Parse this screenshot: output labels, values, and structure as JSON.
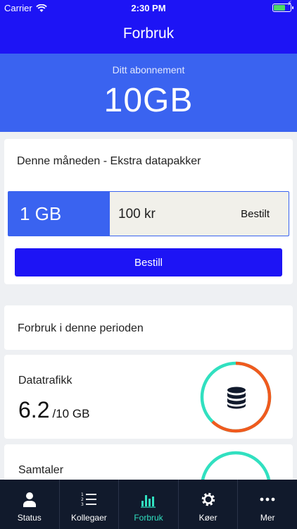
{
  "status_bar": {
    "carrier": "Carrier",
    "time": "2:30 PM"
  },
  "header": {
    "title": "Forbruk"
  },
  "subscription": {
    "label": "Ditt abonnement",
    "value": "10GB"
  },
  "extra_packages": {
    "title": "Denne måneden - Ekstra datapakker",
    "package": {
      "size": "1 GB",
      "price": "100 kr",
      "status": "Bestilt"
    },
    "order_button": "Bestill"
  },
  "period": {
    "title": "Forbruk i denne perioden"
  },
  "data_usage": {
    "label": "Datatrafikk",
    "used": "6.2",
    "limit": "/10 GB",
    "fraction": 0.62
  },
  "calls_usage": {
    "label": "Samtaler"
  },
  "colors": {
    "primary": "#1d14f5",
    "accent_blue": "#3a63f0",
    "ring_used": "#f05a1e",
    "ring_free": "#31e0c0",
    "tabbar": "#111a2c"
  },
  "tabs": [
    {
      "label": "Status",
      "icon": "person-icon"
    },
    {
      "label": "Kollegaer",
      "icon": "list-icon"
    },
    {
      "label": "Forbruk",
      "icon": "bar-chart-icon",
      "active": true
    },
    {
      "label": "Køer",
      "icon": "gear-icon"
    },
    {
      "label": "Mer",
      "icon": "more-icon"
    }
  ]
}
